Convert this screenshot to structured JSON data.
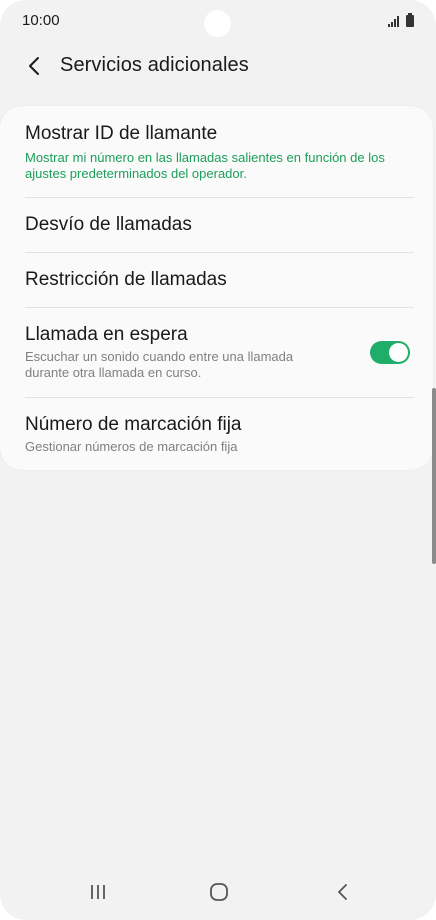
{
  "status_bar": {
    "time": "10:00",
    "signal_icon": "signal-icon",
    "battery_icon": "battery-icon"
  },
  "header": {
    "back_icon": "chevron-left-icon",
    "title": "Servicios adicionales"
  },
  "settings": {
    "items": [
      {
        "title": "Mostrar ID de llamante",
        "subtitle": "Mostrar mi número en las llamadas salientes en función de los ajustes predeterminados del operador."
      },
      {
        "title": "Desvío de llamadas"
      },
      {
        "title": "Restricción de llamadas"
      },
      {
        "title": "Llamada en espera",
        "subtitle": "Escuchar un sonido cuando entre una llamada durante otra llamada en curso.",
        "toggle_on": true
      },
      {
        "title": "Número de marcación fija",
        "subtitle": "Gestionar números de marcación fija"
      }
    ]
  },
  "nav_bar": {
    "recent_icon": "recent-apps-icon",
    "home_icon": "home-icon",
    "back_icon": "back-icon"
  },
  "colors": {
    "accent_green": "#1fae69",
    "subtitle_green": "#1c9e5a",
    "background": "#f2f2f2",
    "card": "#fafafa"
  }
}
